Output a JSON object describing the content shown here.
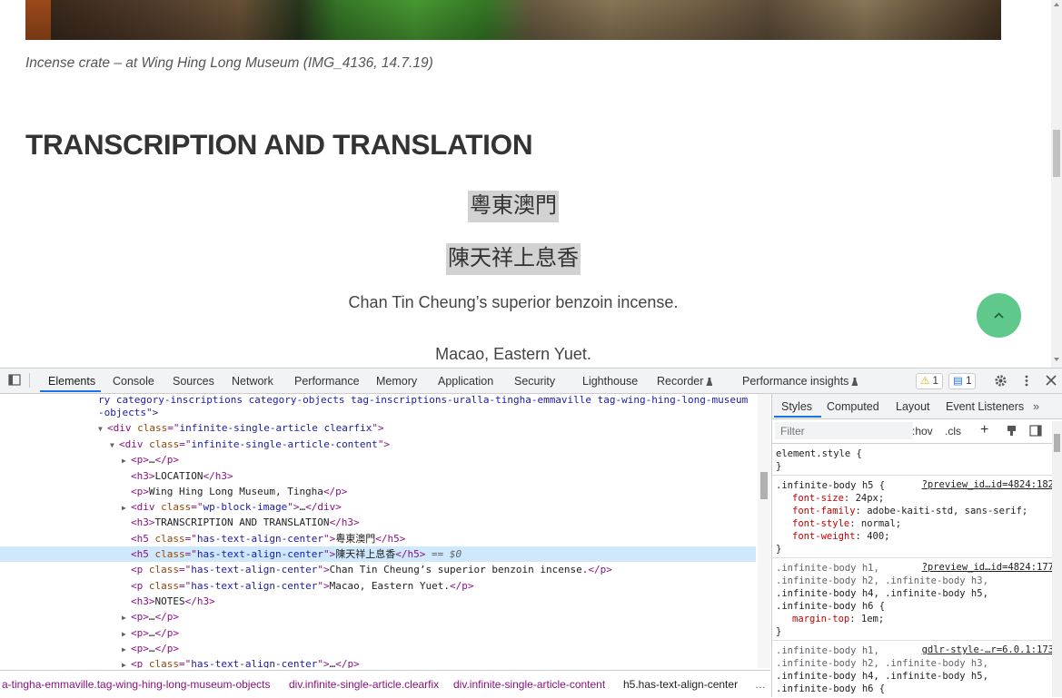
{
  "page": {
    "caption": "Incense crate – at Wing Hing Long Museum (IMG_4136, 14.7.19)",
    "heading": "TRANSCRIPTION AND TRANSLATION",
    "chinese_line_1": "粵東澳門",
    "chinese_line_2": "陳天祥上息香",
    "translation_1": "Chan Tin Cheung’s superior benzoin incense.",
    "translation_2": "Macao, Eastern Yuet.",
    "back_to_top_icon": "chevron-up-icon",
    "accent_color": "#5ec98a"
  },
  "devtools": {
    "tabs": [
      "Elements",
      "Console",
      "Sources",
      "Network",
      "Performance",
      "Memory",
      "Application",
      "Security",
      "Lighthouse",
      "Recorder",
      "Performance insights"
    ],
    "active_tab": "Elements",
    "warnings_count": "1",
    "messages_count": "1",
    "dom": {
      "top_line": "ry category-inscriptions category-objects tag-inscriptions-uralla-tingha-emmaville tag-wing-hing-long-museum",
      "objects_line": "-objects\">",
      "article_tag": "div",
      "article_attr": "class",
      "article_class": "infinite-single-article clearfix",
      "content_class": "infinite-single-article-content",
      "p_collapsed": "…",
      "h3_location": "LOCATION",
      "p_location": "Wing Hing Long Museum, Tingha",
      "image_class": "wp-block-image",
      "h3_transcription": "TRANSCRIPTION AND TRANSLATION",
      "center_class": "has-text-align-center",
      "h5_1": "粵東澳門",
      "h5_2": "陳天祥上息香",
      "selected_marker": "== $0",
      "p_center_1": "Chan Tin Cheung’s superior benzoin incense.",
      "p_center_2": "Macao, Eastern Yuet.",
      "h3_notes": "NOTES"
    },
    "breadcrumbs": [
      "a-tingha-emmaville.tag-wing-hing-long-museum-objects",
      "div.infinite-single-article.clearfix",
      "div.infinite-single-article-content",
      "h5.has-text-align-center",
      "…"
    ],
    "styles": {
      "tabs": [
        "Styles",
        "Computed",
        "Layout",
        "Event Listeners"
      ],
      "active_tab": "Styles",
      "filter_placeholder": "Filter",
      "hov": ":hov",
      "cls": ".cls",
      "element_style": "element.style {",
      "close_brace": "}",
      "rule1_selector": ".infinite-body h5 {",
      "rule1_source": "?preview_id…id=4824:182",
      "rule1_decls": [
        {
          "name": "font-size",
          "value": "24px;"
        },
        {
          "name": "font-family",
          "value": "adobe-kaiti-std, sans-serif;"
        },
        {
          "name": "font-style",
          "value": "normal;"
        },
        {
          "name": "font-weight",
          "value": "400;"
        }
      ],
      "rule2_selector_lines": [
        ".infinite-body h1,",
        ".infinite-body h2, .infinite-body h3,",
        ".infinite-body h4, .infinite-body h5,",
        ".infinite-body h6 {"
      ],
      "rule2_source": "?preview_id…id=4824:177",
      "rule2_decl_name": "margin-top",
      "rule2_decl_value": "1em;",
      "rule3_selector_lines": [
        ".infinite-body h1,",
        ".infinite-body h2, .infinite-body h3,",
        ".infinite-body h4, .infinite-body h5,",
        ".infinite-body h6 {"
      ],
      "rule3_source": "gdlr-style-…r=6.0.1:173"
    }
  }
}
